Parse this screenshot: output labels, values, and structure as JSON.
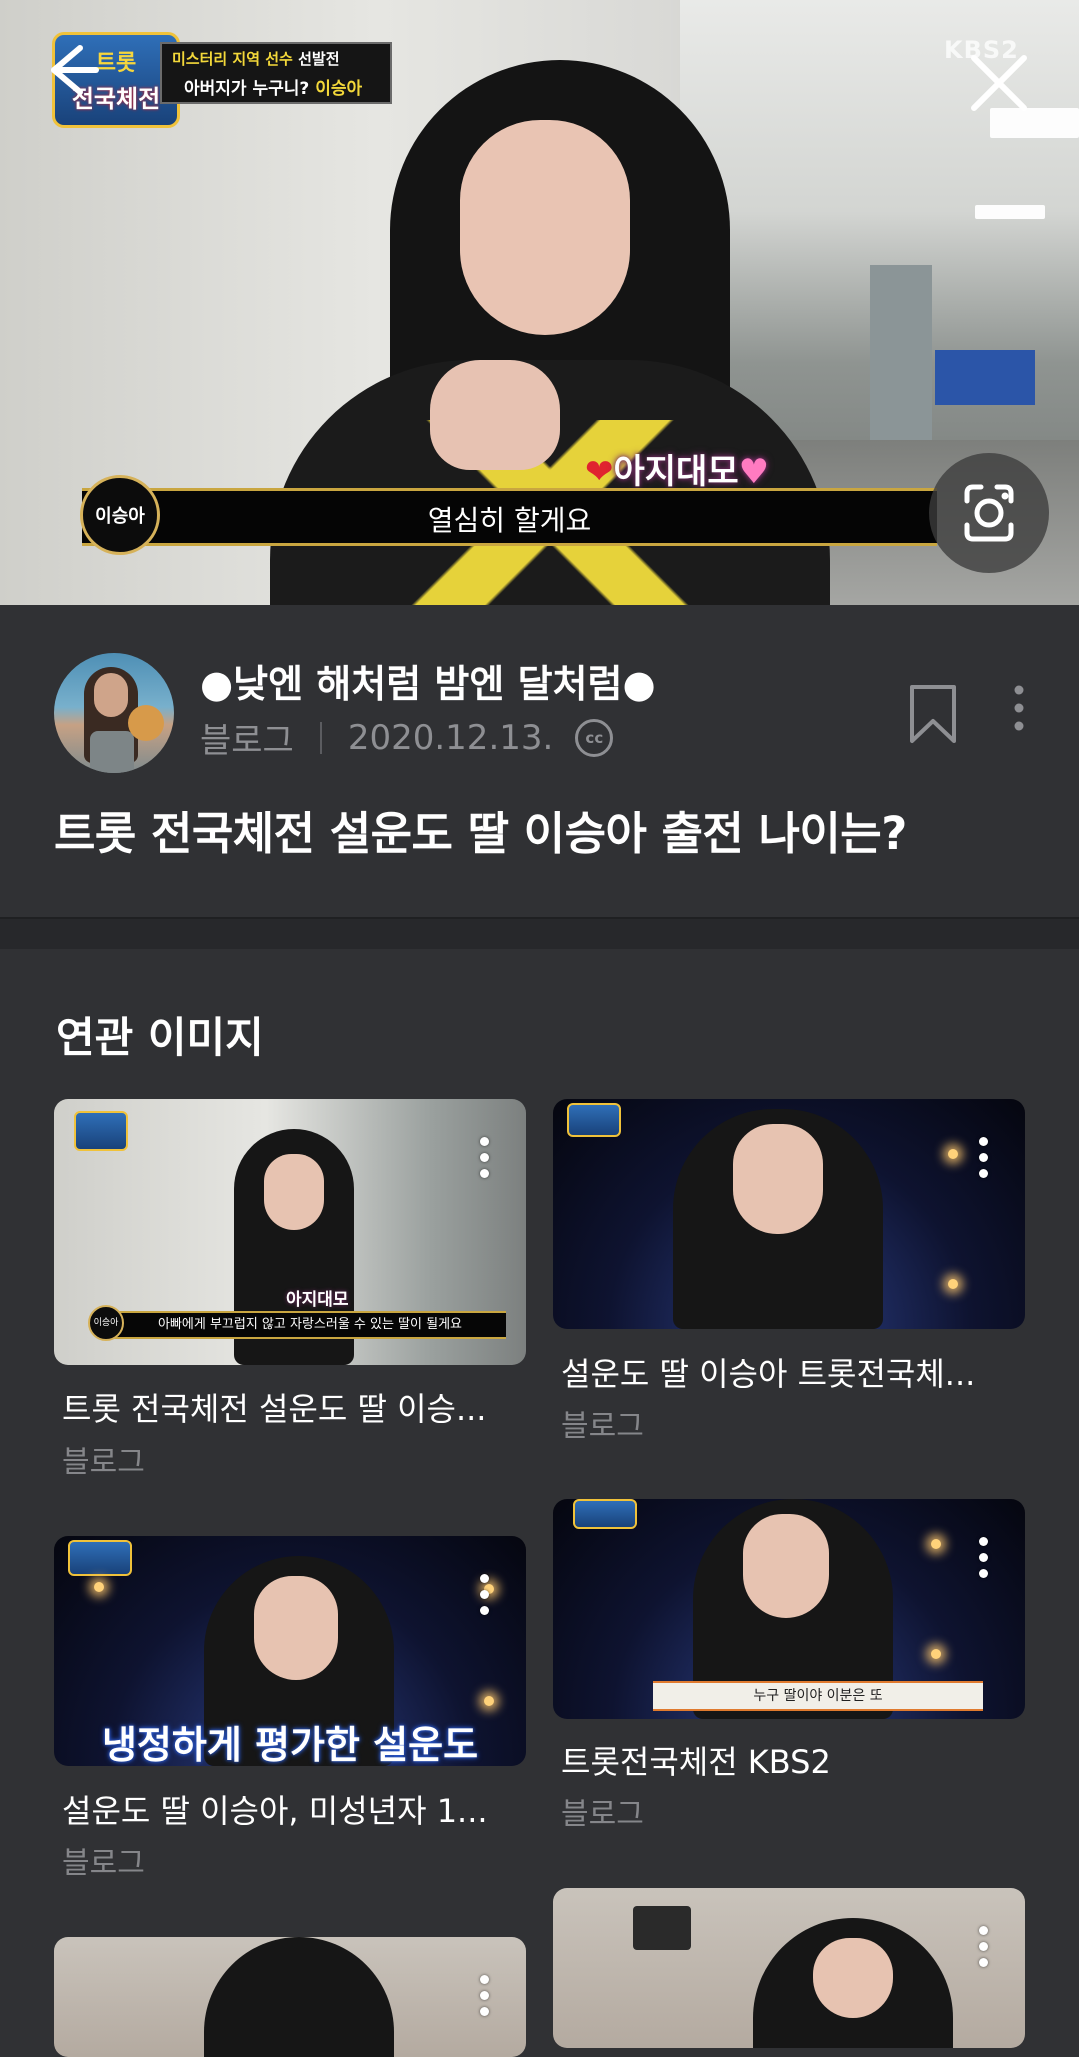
{
  "hero": {
    "show_logo_top": "트롯",
    "show_logo_bottom": "전국체전",
    "caption_tag": "미스터리 지역 선수",
    "caption_tag_white": "선발전",
    "caption_question": "아버지가 누구니?",
    "caption_name": "이승아",
    "channel_logo": "KBS2",
    "love_tag": "아지대모",
    "name_badge": "이승아",
    "subtitle": "열심히 할게요"
  },
  "post": {
    "blog_name": "●낮엔 해처럼 밤엔 달처럼●",
    "source_type": "블로그",
    "date": "2020.12.13.",
    "license_badge": "cc",
    "title": "트롯 전국체전 설운도 딸 이승아 출전 나이는?"
  },
  "related": {
    "section_title": "연관 이미지",
    "cards": [
      {
        "title": "트롯 전국체전 설운도 딸 이승...",
        "source": "블로그",
        "thumb_caption": "아빠에게 부끄럽지 않고 자랑스러울 수 있는 딸이 될게요",
        "thumb_tag": "아지대모",
        "badge": "이승아"
      },
      {
        "title": "설운도 딸 이승아 트롯전국체...",
        "source": "블로그"
      },
      {
        "title": "설운도 딸 이승아, 미성년자 1...",
        "source": "블로그",
        "thumb_caption": "냉정하게 평가한 설운도"
      },
      {
        "title": "트롯전국체전 KBS2",
        "source": "블로그",
        "thumb_caption": "누구 딸이야 이분은 또"
      },
      {
        "title": "",
        "source": ""
      },
      {
        "title": "",
        "source": ""
      }
    ]
  },
  "icons": {
    "back": "arrow-left-icon",
    "close": "close-icon",
    "lens": "camera-lens-icon",
    "bookmark": "bookmark-icon",
    "more": "more-vertical-icon"
  },
  "colors": {
    "background": "#303134",
    "text_primary": "#ffffff",
    "text_secondary": "#8e8f93"
  }
}
